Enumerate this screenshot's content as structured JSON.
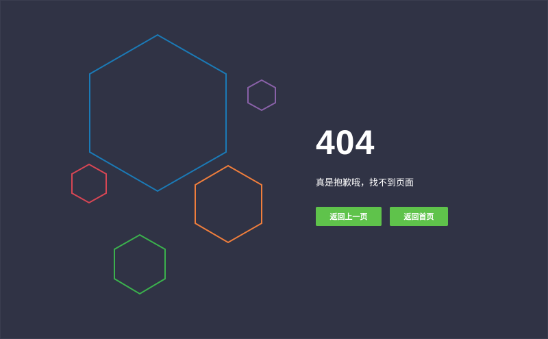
{
  "error": {
    "code": "404",
    "message": "真是抱歉哦，找不到页面"
  },
  "buttons": {
    "back_label": "返回上一页",
    "home_label": "返回首页",
    "color": "#5fc34b"
  },
  "background_color": "#303345",
  "hexagon_colors": {
    "large": "#1b7ab6",
    "small_purple": "#8961a8",
    "small_red": "#d84654",
    "medium_orange": "#f07e3c",
    "medium_green": "#3bb14d"
  }
}
